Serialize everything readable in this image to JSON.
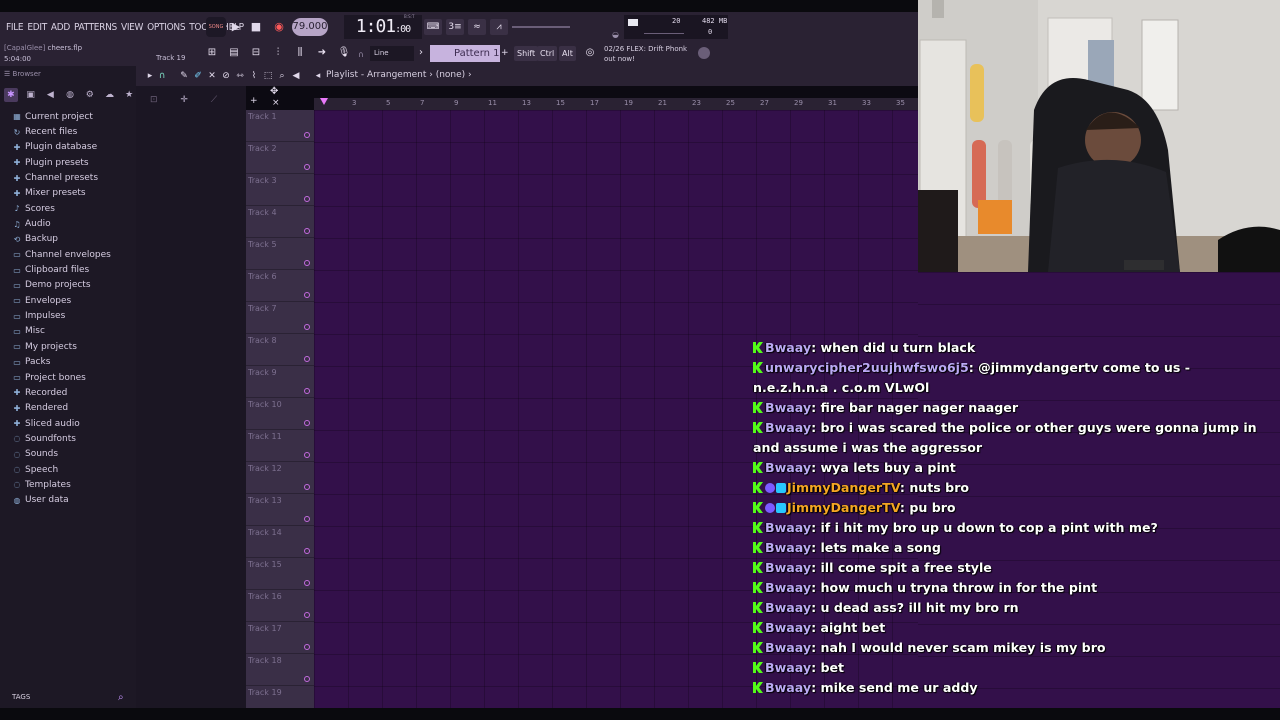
{
  "menu": [
    "FILE",
    "EDIT",
    "ADD",
    "PATTERNS",
    "VIEW",
    "OPTIONS",
    "TOOLS",
    "HELP"
  ],
  "transport": {
    "mode": "SONG",
    "tempo": "79.000",
    "time_main": "1:01",
    "time_ticks": ":00",
    "time_unit": "B:S:T"
  },
  "cpu": {
    "value": "20",
    "memory": "482 MB",
    "polyphony": "0"
  },
  "project": {
    "tag": "[CapalGlee]",
    "name": "cheers.flp",
    "length": "5:04:00",
    "hint": "Track 19"
  },
  "toolbar": {
    "snap": "Line",
    "pattern": "Pattern 1",
    "keys": [
      "Shift",
      "Ctrl",
      "Alt"
    ],
    "news_date": "02/26",
    "news_title": "FLEX: Drift Phonk",
    "news_sub": "out now!"
  },
  "browser": {
    "header": "Browser",
    "items": [
      {
        "label": "Current project",
        "icon": "project-icon"
      },
      {
        "label": "Recent files",
        "icon": "recent-icon"
      },
      {
        "label": "Plugin database",
        "icon": "plugin-db-icon"
      },
      {
        "label": "Plugin presets",
        "icon": "plugin-presets-icon"
      },
      {
        "label": "Channel presets",
        "icon": "channel-presets-icon"
      },
      {
        "label": "Mixer presets",
        "icon": "mixer-presets-icon"
      },
      {
        "label": "Scores",
        "icon": "scores-icon"
      },
      {
        "label": "Audio",
        "icon": "audio-icon"
      },
      {
        "label": "Backup",
        "icon": "backup-icon"
      },
      {
        "label": "Channel envelopes",
        "icon": "folder-icon"
      },
      {
        "label": "Clipboard files",
        "icon": "folder-icon"
      },
      {
        "label": "Demo projects",
        "icon": "folder-icon"
      },
      {
        "label": "Envelopes",
        "icon": "folder-icon"
      },
      {
        "label": "Impulses",
        "icon": "folder-icon"
      },
      {
        "label": "Misc",
        "icon": "folder-icon"
      },
      {
        "label": "My projects",
        "icon": "folder-icon"
      },
      {
        "label": "Packs",
        "icon": "folder-icon"
      },
      {
        "label": "Project bones",
        "icon": "folder-icon"
      },
      {
        "label": "Recorded",
        "icon": "recorded-icon"
      },
      {
        "label": "Rendered",
        "icon": "rendered-icon"
      },
      {
        "label": "Sliced audio",
        "icon": "sliced-icon"
      },
      {
        "label": "Soundfonts",
        "icon": "soundfonts-icon"
      },
      {
        "label": "Sounds",
        "icon": "sounds-icon"
      },
      {
        "label": "Speech",
        "icon": "speech-icon"
      },
      {
        "label": "Templates",
        "icon": "templates-icon"
      },
      {
        "label": "User data",
        "icon": "user-data-icon"
      }
    ],
    "tags_label": "TAGS"
  },
  "playlist": {
    "title": "Playlist - Arrangement",
    "breadcrumb": "(none)",
    "ruler": [
      "3",
      "5",
      "7",
      "9",
      "11",
      "13",
      "15",
      "17",
      "19",
      "21",
      "23",
      "25",
      "27",
      "29",
      "31",
      "33",
      "35"
    ],
    "tracks": [
      "Track 1",
      "Track 2",
      "Track 3",
      "Track 4",
      "Track 5",
      "Track 6",
      "Track 7",
      "Track 8",
      "Track 9",
      "Track 10",
      "Track 11",
      "Track 12",
      "Track 13",
      "Track 14",
      "Track 15",
      "Track 16",
      "Track 17",
      "Track 18",
      "Track 19"
    ]
  },
  "chat": [
    {
      "user": "Bwaay",
      "color": "#bba9f5",
      "message": "when did u turn black",
      "badges": [
        "k"
      ]
    },
    {
      "user": "unwarycipher2uujhwfswo6j5",
      "color": "#bba9f5",
      "message": "@jimmydangertv come to us - n.e.z.h.n.a . c.o.m VLwOl",
      "badges": [
        "k"
      ]
    },
    {
      "user": "Bwaay",
      "color": "#bba9f5",
      "message": "fire bar nager nager naager",
      "badges": [
        "k"
      ]
    },
    {
      "user": "Bwaay",
      "color": "#bba9f5",
      "message": "bro i was scared the police or other guys were gonna jump in and assume i was the aggressor",
      "badges": [
        "k"
      ]
    },
    {
      "user": "Bwaay",
      "color": "#bba9f5",
      "message": "wya lets buy a pint",
      "badges": [
        "k"
      ]
    },
    {
      "user": "JimmyDangerTV",
      "color": "#f5a623",
      "message": "nuts bro",
      "badges": [
        "k",
        "c"
      ]
    },
    {
      "user": "JimmyDangerTV",
      "color": "#f5a623",
      "message": "pu bro",
      "badges": [
        "k",
        "c"
      ]
    },
    {
      "user": "Bwaay",
      "color": "#bba9f5",
      "message": "if i hit my bro up u down to cop a pint with me?",
      "badges": [
        "k"
      ]
    },
    {
      "user": "Bwaay",
      "color": "#bba9f5",
      "message": "lets make a song",
      "badges": [
        "k"
      ]
    },
    {
      "user": "Bwaay",
      "color": "#bba9f5",
      "message": "ill come spit a free style",
      "badges": [
        "k"
      ]
    },
    {
      "user": "Bwaay",
      "color": "#bba9f5",
      "message": "how much u tryna throw in for the pint",
      "badges": [
        "k"
      ]
    },
    {
      "user": "Bwaay",
      "color": "#bba9f5",
      "message": "u dead ass? ill hit my bro rn",
      "badges": [
        "k"
      ]
    },
    {
      "user": "Bwaay",
      "color": "#bba9f5",
      "message": "aight bet",
      "badges": [
        "k"
      ]
    },
    {
      "user": "Bwaay",
      "color": "#bba9f5",
      "message": "nah I would never scam mikey is my bro",
      "badges": [
        "k"
      ]
    },
    {
      "user": "Bwaay",
      "color": "#bba9f5",
      "message": "bet",
      "badges": [
        "k"
      ]
    },
    {
      "user": "Bwaay",
      "color": "#bba9f5",
      "message": "mike send me ur addy",
      "badges": [
        "k"
      ]
    }
  ],
  "colors": {
    "grid": "#33104a",
    "panel": "#2a2233",
    "accent": "#c794ff",
    "badge_green": "#53fc18"
  }
}
